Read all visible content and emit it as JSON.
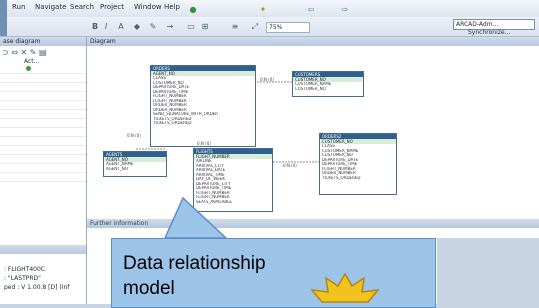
{
  "menu": {
    "items": [
      "Run",
      "Navigate",
      "Search",
      "Project",
      "Window",
      "Help"
    ]
  },
  "toolbar": {
    "zoom": "75%",
    "perspective": "ARCAD-Adm...",
    "synchronize": "Synchronize..."
  },
  "left_panel": {
    "title": "ase diagram",
    "column_header": "Act...",
    "properties": [
      ": FLIGHT400C",
      ": \"LASTPRD\"",
      "ped : V 1.00.8 [D] (Inf"
    ]
  },
  "editor": {
    "title": "Diagram",
    "tables": [
      {
        "name": "ORDERS",
        "pk": "AGENT_NO",
        "rows": [
          "CLASS",
          "CUSTOMER_NO",
          "DEPARTURE_DATE",
          "DEPARTURE_TIME",
          "FLIGHT_NUMBER",
          "FLIGHT_NUMBER",
          "ORDER_NUMBER",
          "ORDER_NUMBER",
          "SEND_SIGNATURE_WITH_ORDER",
          "TICKETS_ORDERED",
          "TICKETS_ORDERED"
        ]
      },
      {
        "name": "CUSTOMERS",
        "pk": "CUSTOMER_NO",
        "rows": [
          "CUSTOMER_NAME",
          "CUSTOMER_NO"
        ]
      },
      {
        "name": "AGENTS",
        "pk": "AGENT_NO",
        "rows": [
          "AGENT_NAME",
          "AGENT_NO"
        ]
      },
      {
        "name": "FLIGHTS",
        "pk": "FLIGHT_NUMBER",
        "rows": [
          "AIRLINE",
          "ARRIVAL_CITY",
          "ARRIVAL_DATE",
          "ARRIVAL_TIME",
          "DAY_OF_WEEK",
          "DEPARTURE_CITY",
          "DEPARTURE_TIME",
          "FLIGHT_NUMBER",
          "FLIGHT_NUMBER",
          "SEATS_AVAILABLE"
        ]
      },
      {
        "name": "ORDERS2",
        "pk": "CUSTOMER_NO",
        "rows": [
          "CLASS",
          "CUSTOMER_NAME",
          "CUSTOMER_NO",
          "DEPARTURE_DATE",
          "DEPARTURE_TIME",
          "FLIGHT_NUMBER",
          "ORDER_NUMBER",
          "TICKETS_ORDERED"
        ]
      }
    ],
    "relations": [
      "0:N (0)",
      "0:N (0)",
      "0:N (0)",
      "0:N (0)"
    ]
  },
  "further_info": {
    "title": "Further information"
  },
  "callout": {
    "line1": "Data relationship",
    "line2": "model"
  },
  "colors": {
    "callout_fill": "#9cc3e8",
    "table_header": "#2d5f8f",
    "burst": "#f2c21f"
  }
}
